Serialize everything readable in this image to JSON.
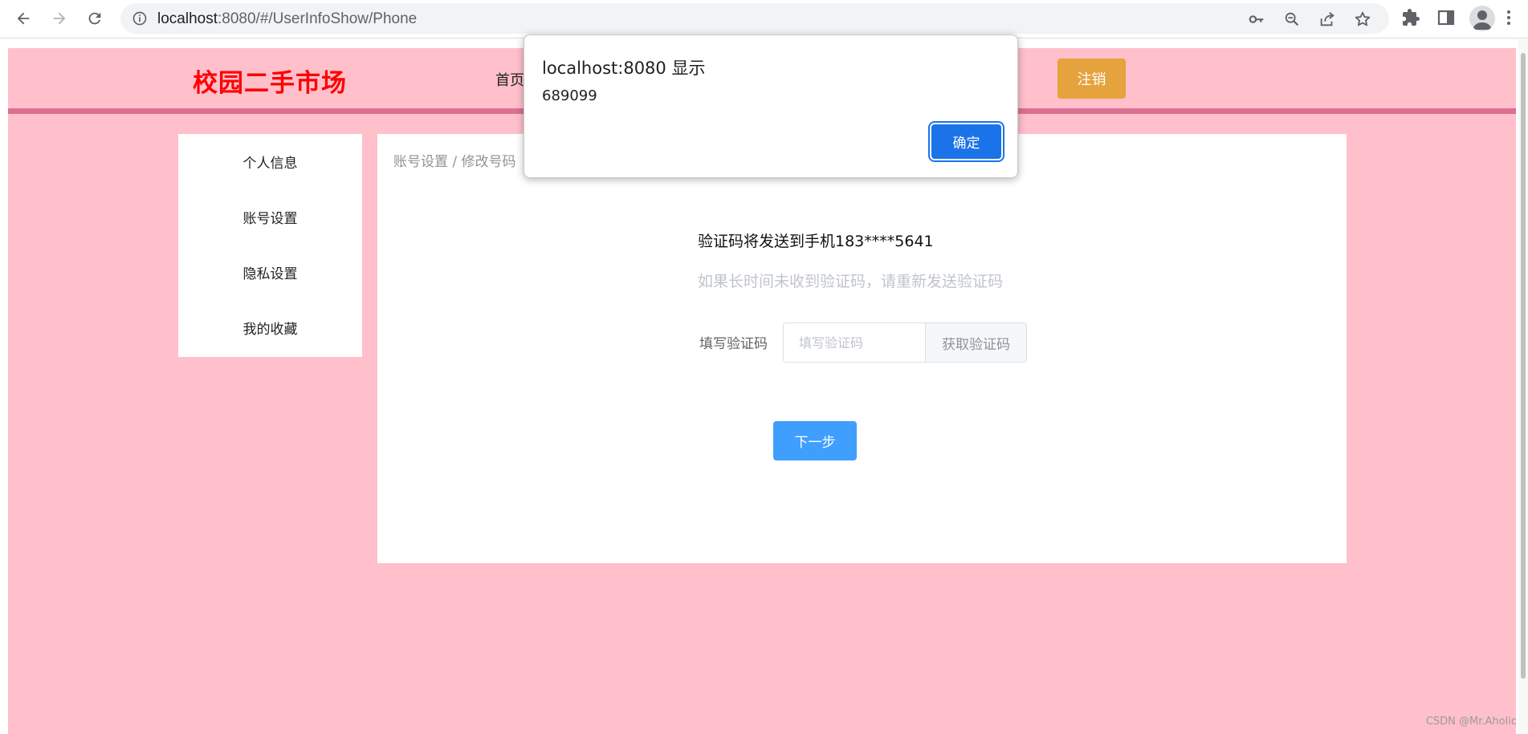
{
  "browser": {
    "url_host": "localhost",
    "url_rest": ":8080/#/UserInfoShow/Phone",
    "icons": [
      "back-icon",
      "forward-icon",
      "reload-icon",
      "info-icon",
      "key-icon",
      "zoom-icon",
      "share-icon",
      "star-icon",
      "extensions-icon",
      "sidepanel-icon",
      "profile-icon",
      "menu-icon"
    ]
  },
  "header": {
    "logo": "校园二手市场",
    "nav_home": "首页",
    "logout": "注销"
  },
  "sidebar": {
    "items": [
      {
        "label": "个人信息"
      },
      {
        "label": "账号设置"
      },
      {
        "label": "隐私设置"
      },
      {
        "label": "我的收藏"
      }
    ]
  },
  "main": {
    "breadcrumb": "账号设置 / 修改号码",
    "send_to": "验证码将发送到手机183****5641",
    "hint": "如果长时间未收到验证码，请重新发送验证码",
    "code_label": "填写验证码",
    "code_placeholder": "填写验证码",
    "get_code": "获取验证码",
    "next": "下一步"
  },
  "dialog": {
    "title": "localhost:8080 显示",
    "message": "689099",
    "ok": "确定"
  },
  "watermark": "CSDN @Mr.Aholic",
  "colors": {
    "page_bg": "#ffc0cb",
    "header_line": "#db7093",
    "logo": "#ff0000",
    "logout": "#e6a23c",
    "primary": "#409eff",
    "dialog_ok": "#1a73e8"
  }
}
